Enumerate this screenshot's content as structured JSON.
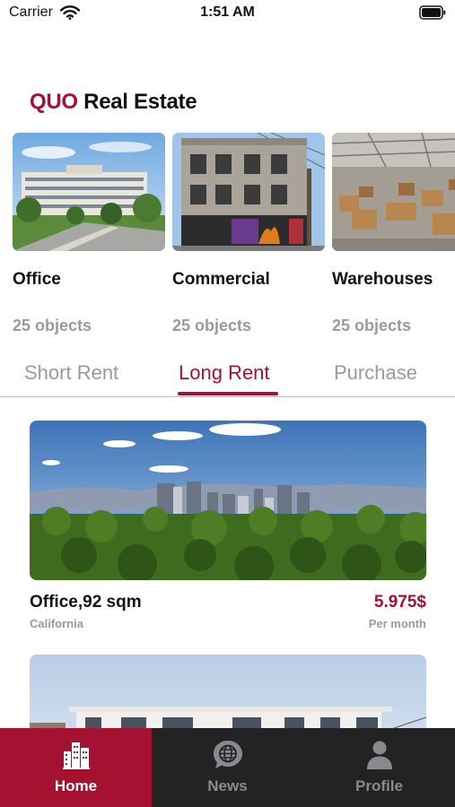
{
  "status_bar": {
    "carrier": "Carrier",
    "time": "1:51 AM",
    "wifi_icon": "wifi-icon",
    "battery_icon": "battery-icon"
  },
  "header": {
    "brand": "QUO",
    "title_rest": "Real Estate"
  },
  "colors": {
    "accent": "#a51131",
    "muted": "#9a9a9a",
    "nav_background": "#232326"
  },
  "categories": [
    {
      "name": "Office",
      "count": "25 objects"
    },
    {
      "name": "Commercial",
      "count": "25 objects"
    },
    {
      "name": "Warehouses",
      "count": "25 objects"
    }
  ],
  "tabs": [
    {
      "label": "Short Rent",
      "active": false
    },
    {
      "label": "Long Rent",
      "active": true
    },
    {
      "label": "Purchase",
      "active": false
    }
  ],
  "listings": [
    {
      "title": "Office,92 sqm",
      "location": "California",
      "price": "5.975$",
      "period": "Per month"
    }
  ],
  "nav": [
    {
      "label": "Home",
      "icon": "buildings-icon",
      "active": true
    },
    {
      "label": "News",
      "icon": "globe-chat-icon",
      "active": false
    },
    {
      "label": "Profile",
      "icon": "person-icon",
      "active": false
    }
  ]
}
